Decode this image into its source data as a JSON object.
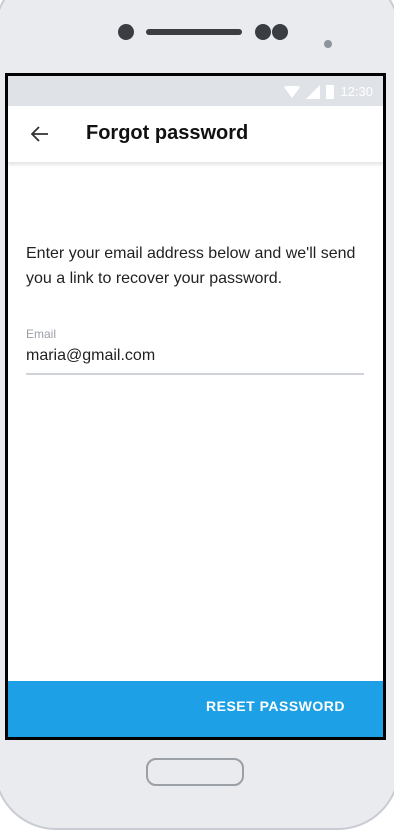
{
  "status_bar": {
    "time": "12:30"
  },
  "app_bar": {
    "title": "Forgot password"
  },
  "content": {
    "description": "Enter your email address below and we'll send you a link to recover your password.",
    "email_label": "Email",
    "email_value": "maria@gmail.com"
  },
  "actions": {
    "reset_label": "RESET PASSWORD"
  },
  "colors": {
    "accent": "#1ea0e6",
    "status_bar_bg": "#dfe2e6"
  }
}
